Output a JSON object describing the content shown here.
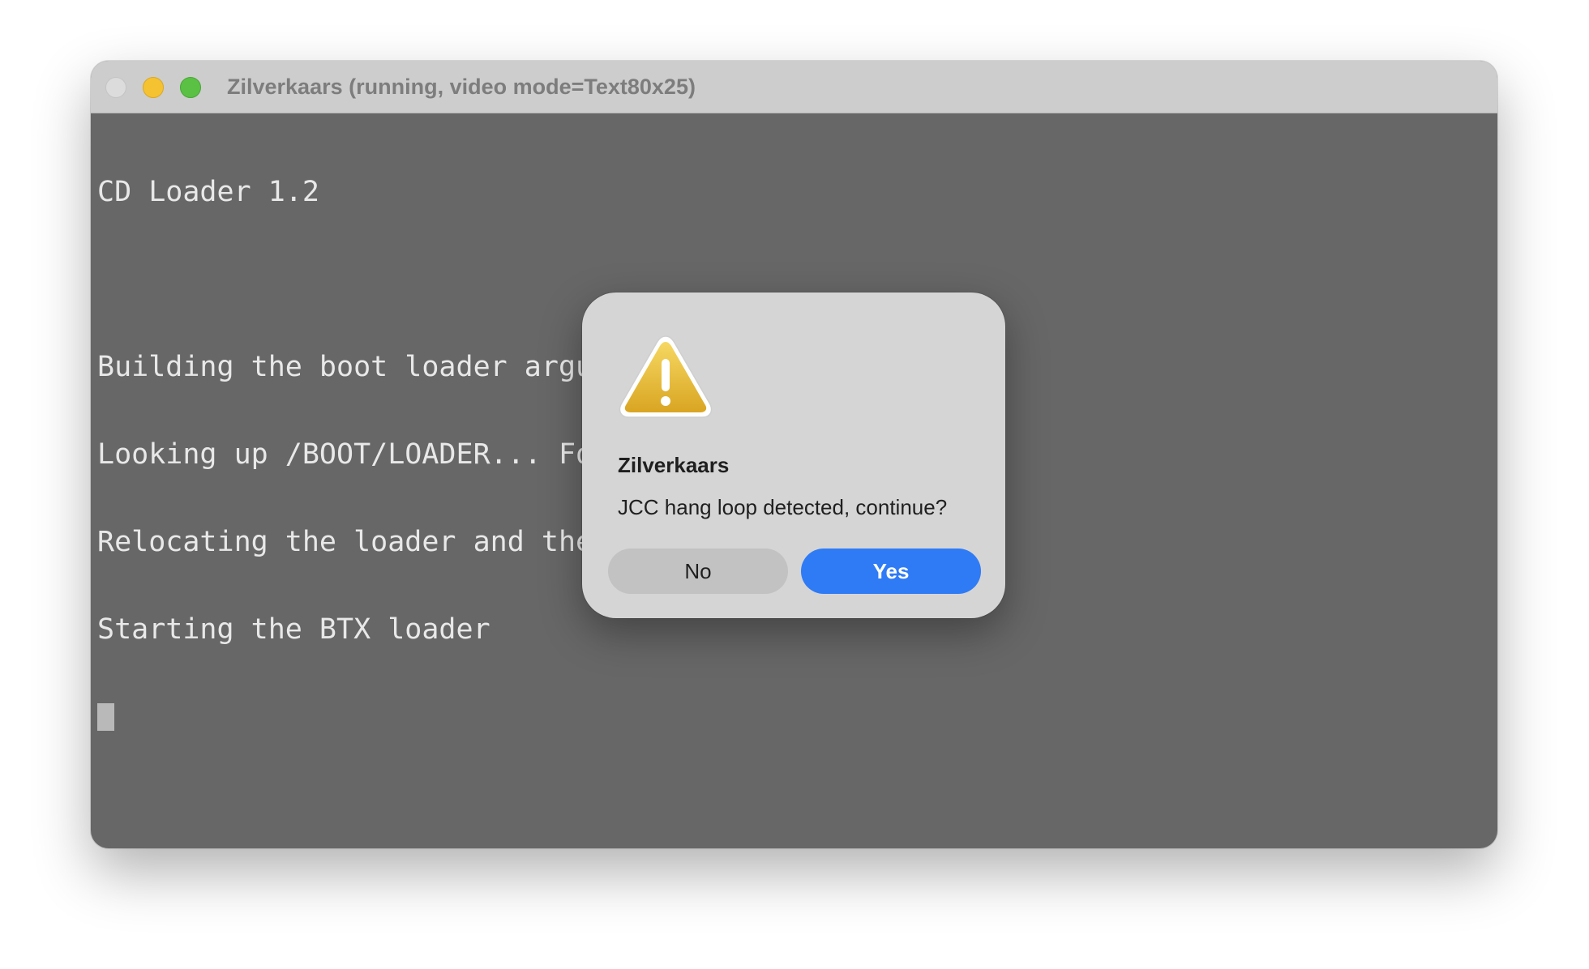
{
  "window": {
    "title": "Zilverkaars (running, video mode=Text80x25)",
    "traffic_lights": {
      "close_color": "#dcdcdc",
      "minimize_color": "#f5c232",
      "zoom_color": "#5ac144"
    }
  },
  "terminal": {
    "lines": [
      "CD Loader 1.2",
      "",
      "Building the boot loader arguments",
      "Looking up /BOOT/LOADER... Found",
      "Relocating the loader and the BTX",
      "Starting the BTX loader"
    ],
    "cursor_visible": true
  },
  "dialog": {
    "icon": "warning-icon",
    "title": "Zilverkaars",
    "message": "JCC hang loop detected, continue?",
    "buttons": {
      "no_label": "No",
      "yes_label": "Yes"
    },
    "accent_color": "#2f7bf6"
  }
}
